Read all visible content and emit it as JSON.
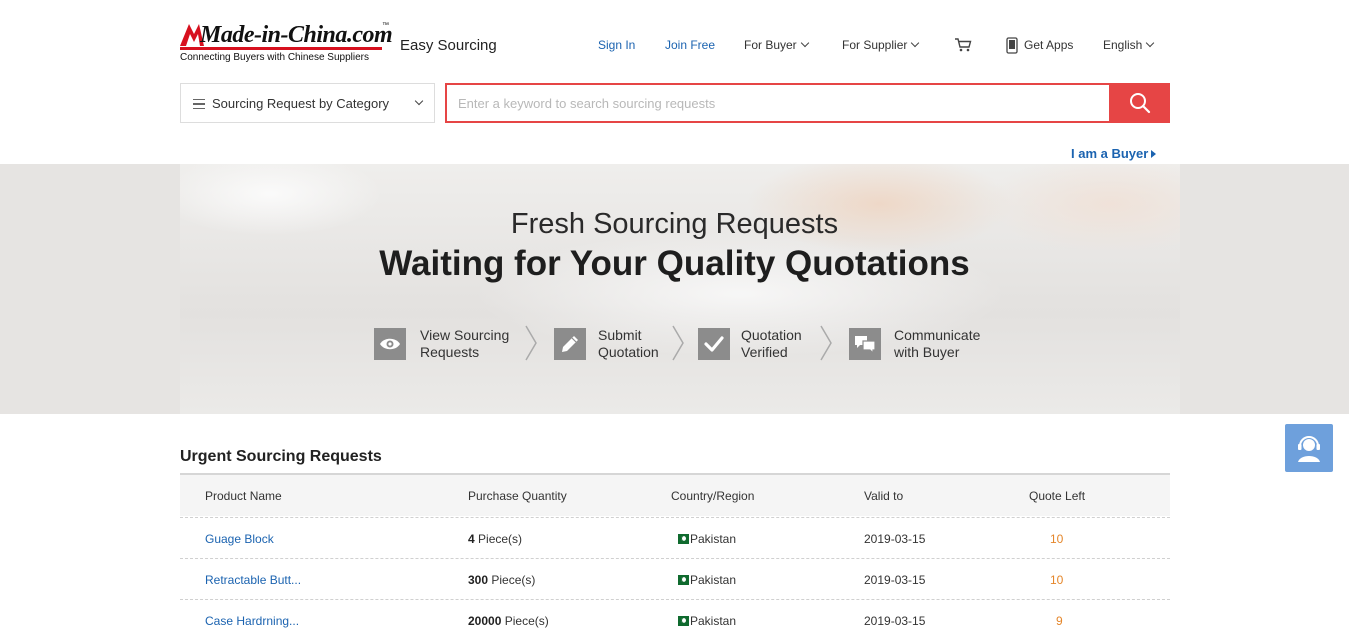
{
  "header": {
    "logo_text": "Made-in-China.com",
    "logo_tm": "™",
    "logo_tagline": "Connecting Buyers with Chinese Suppliers",
    "product_name": "Easy Sourcing",
    "nav": {
      "sign_in": "Sign In",
      "join_free": "Join Free",
      "for_buyer": "For Buyer",
      "for_supplier": "For Supplier",
      "get_apps": "Get Apps",
      "language": "English"
    },
    "icons": {
      "cart": "cart-icon",
      "apps": "phone-icon"
    }
  },
  "search": {
    "category_label": "Sourcing Request by Category",
    "placeholder": "Enter a keyword to search sourcing requests",
    "value": ""
  },
  "role_switch": "I am a Buyer",
  "banner": {
    "title_line1": "Fresh Sourcing Requests",
    "title_line2": "Waiting for Your Quality Quotations",
    "steps": [
      {
        "icon": "eye-icon",
        "line1": "View Sourcing",
        "line2": "Requests"
      },
      {
        "icon": "pencil-icon",
        "line1": "Submit",
        "line2": "Quotation"
      },
      {
        "icon": "check-icon",
        "line1": "Quotation",
        "line2": "Verified"
      },
      {
        "icon": "chat-icon",
        "line1": "Communicate",
        "line2": "with Buyer"
      }
    ]
  },
  "colors": {
    "accent_red": "#e64545",
    "link_blue": "#1b63b0",
    "quote_orange": "#e5862a",
    "support_blue": "#6ea0dc"
  },
  "requests": {
    "title": "Urgent Sourcing Requests",
    "columns": [
      "Product Name",
      "Purchase Quantity",
      "Country/Region",
      "Valid to",
      "Quote Left"
    ],
    "rows": [
      {
        "product": "Guage Block",
        "qty": "4",
        "unit": "Piece(s)",
        "country": "Pakistan",
        "valid_to": "2019-03-15",
        "quote_left": "10"
      },
      {
        "product": "Retractable Butt...",
        "qty": "300",
        "unit": "Piece(s)",
        "country": "Pakistan",
        "valid_to": "2019-03-15",
        "quote_left": "10"
      },
      {
        "product": "Case Hardrning...",
        "qty": "20000",
        "unit": "Piece(s)",
        "country": "Pakistan",
        "valid_to": "2019-03-15",
        "quote_left": "9"
      }
    ]
  }
}
